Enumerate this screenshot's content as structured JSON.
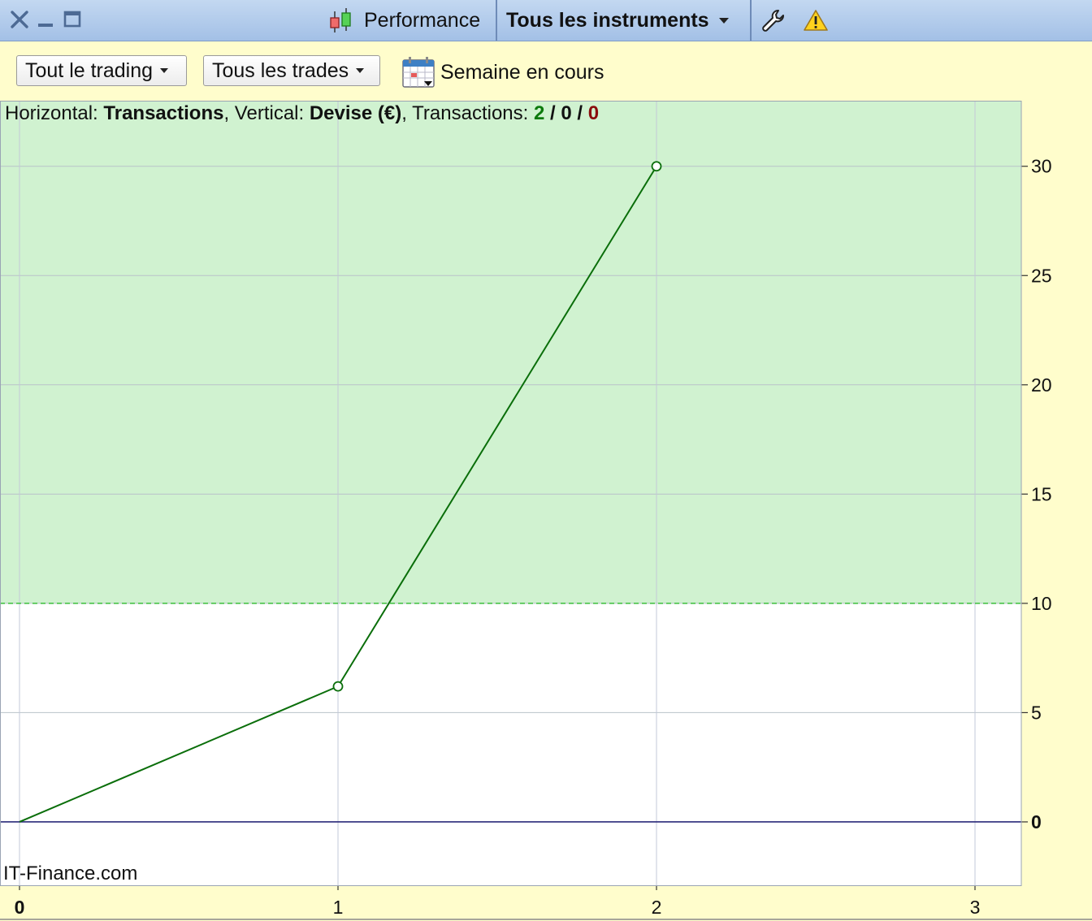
{
  "titlebar": {
    "tab_label": "Performance",
    "instrument_selector": "Tous les instruments",
    "icons": [
      "close-icon",
      "minimize-icon",
      "maximize-icon",
      "candlestick-icon",
      "wrench-icon",
      "warning-icon"
    ]
  },
  "toolbar": {
    "trading_filter": "Tout le trading",
    "trades_filter": "Tous les trades",
    "period": "Semaine en cours"
  },
  "chart_header": {
    "horizontal_label": "Horizontal:",
    "horizontal_value": "Transactions",
    "vertical_label": "Vertical:",
    "vertical_value": "Devise (€)",
    "transactions_label": "Transactions:",
    "count_winning": "2",
    "count_neutral": "0",
    "count_losing": "0",
    "separator": "/"
  },
  "watermark": "IT-Finance.com",
  "colors": {
    "line": "#0a6e0a",
    "profit_zone": "#d0f2d0",
    "zero_line": "#2a2a7a",
    "threshold_line": "#3cbf3c"
  },
  "chart_data": {
    "type": "line",
    "x": [
      0,
      1,
      2
    ],
    "y": [
      0,
      6.2,
      30
    ],
    "xlim": [
      0,
      3.15
    ],
    "ylim": [
      -2.9,
      33
    ],
    "x_ticks": [
      "0",
      "1",
      "2",
      "3"
    ],
    "y_ticks": [
      "0",
      "5",
      "10",
      "15",
      "20",
      "25",
      "30"
    ],
    "y_tick_values": [
      0,
      5,
      10,
      15,
      20,
      25,
      30
    ],
    "x_tick_values": [
      0,
      1,
      2,
      3
    ],
    "bold_ticks": [
      "0"
    ],
    "threshold": 10,
    "grid": true,
    "y_axis_side": "right"
  }
}
